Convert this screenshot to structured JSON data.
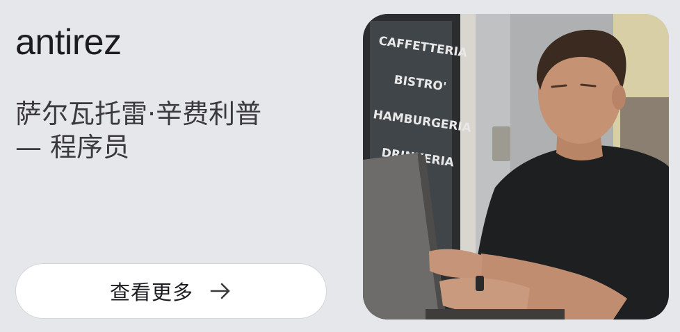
{
  "profile": {
    "username": "antirez",
    "subtitle_line1": "萨尔瓦托雷·辛费利普",
    "subtitle_line2": "— 程序员"
  },
  "actions": {
    "more_label": "查看更多",
    "more_icon": "arrow-right-icon"
  },
  "photo": {
    "window_sign_lines": [
      "CAFFETTERIA",
      "BISTRO'",
      "HAMBURGERIA",
      "DRINKERIA"
    ]
  },
  "colors": {
    "background": "#e6e7eb",
    "text_primary": "#1c1c1e",
    "button_bg": "#ffffff"
  }
}
